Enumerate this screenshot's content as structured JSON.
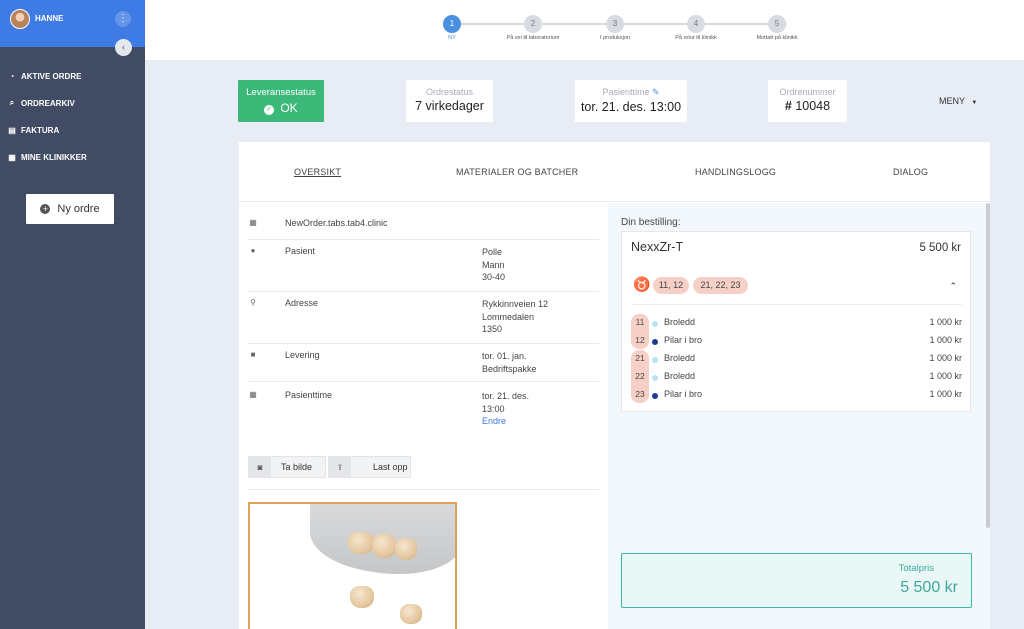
{
  "user": {
    "name": "HANNE"
  },
  "sidebar": {
    "items": [
      {
        "label": "AKTIVE ORDRE",
        "icon": "dashboard-icon"
      },
      {
        "label": "ORDREARKIV",
        "icon": "search-icon"
      },
      {
        "label": "FAKTURA",
        "icon": "document-icon"
      },
      {
        "label": "MINE KLINIKKER",
        "icon": "building-icon"
      }
    ],
    "new_order_label": "Ny ordre"
  },
  "steps": [
    {
      "num": "1",
      "label": "NY",
      "active": true
    },
    {
      "num": "2",
      "label": "På vei til laboratorium",
      "active": false
    },
    {
      "num": "3",
      "label": "I produksjon",
      "active": false
    },
    {
      "num": "4",
      "label": "På retur til klinikk",
      "active": false
    },
    {
      "num": "5",
      "label": "Mottatt på klinikk",
      "active": false
    }
  ],
  "status": {
    "delivery_title": "Leveransestatus",
    "delivery_value": "OK",
    "order_status_title": "Ordrestatus",
    "order_status_value": "7 virkedager",
    "appointment_title": "Pasienttime",
    "appointment_value": "tor. 21. des. 13:00",
    "order_number_title": "Ordrenummer",
    "order_number_value": "10048",
    "menu_label": "MENY"
  },
  "tabs": [
    "OVERSIKT",
    "MATERIALER OG BATCHER",
    "HANDLINGSLOGG",
    "DIALOG"
  ],
  "details": {
    "clinic": "NewOrder.tabs.tab4.clinic",
    "patient_label": "Pasient",
    "patient_lines": [
      "Polle",
      "Mann",
      "30-40"
    ],
    "address_label": "Adresse",
    "address_lines": [
      "Rykkinnveien 12",
      "Lommedalen",
      "1350"
    ],
    "delivery_label": "Levering",
    "delivery_lines": [
      "tor. 01. jan.",
      "Bedriftspakke"
    ],
    "appointment_label": "Pasienttime",
    "appointment_lines": [
      "tor. 21. des.",
      "13:00"
    ],
    "appointment_link": "Endre"
  },
  "photo_buttons": {
    "take_photo": "Ta bilde",
    "upload": "Last opp"
  },
  "order": {
    "header": "Din bestilling:",
    "product": "NexxZr-T",
    "product_price": "5 500 kr",
    "groups": [
      "11, 12",
      "21, 22, 23"
    ],
    "lines": [
      {
        "tooth": "11",
        "type": "Broledd",
        "price": "1 000 kr",
        "color": "#b9e3f2"
      },
      {
        "tooth": "12",
        "type": "Pilar i bro",
        "price": "1 000 kr",
        "color": "#1d3b8f"
      },
      {
        "tooth": "21",
        "type": "Broledd",
        "price": "1 000 kr",
        "color": "#b9e3f2"
      },
      {
        "tooth": "22",
        "type": "Broledd",
        "price": "1 000 kr",
        "color": "#b9e3f2"
      },
      {
        "tooth": "23",
        "type": "Pilar i bro",
        "price": "1 000 kr",
        "color": "#1d3b8f"
      }
    ],
    "total_label": "Totalpris",
    "total_value": "5 500 kr"
  },
  "colors": {
    "sidebar": "#414b63",
    "user_bar": "#3f7be4",
    "ok_green": "#3cb878",
    "accent_blue": "#4a90e2",
    "total_teal": "#3fa89a"
  }
}
